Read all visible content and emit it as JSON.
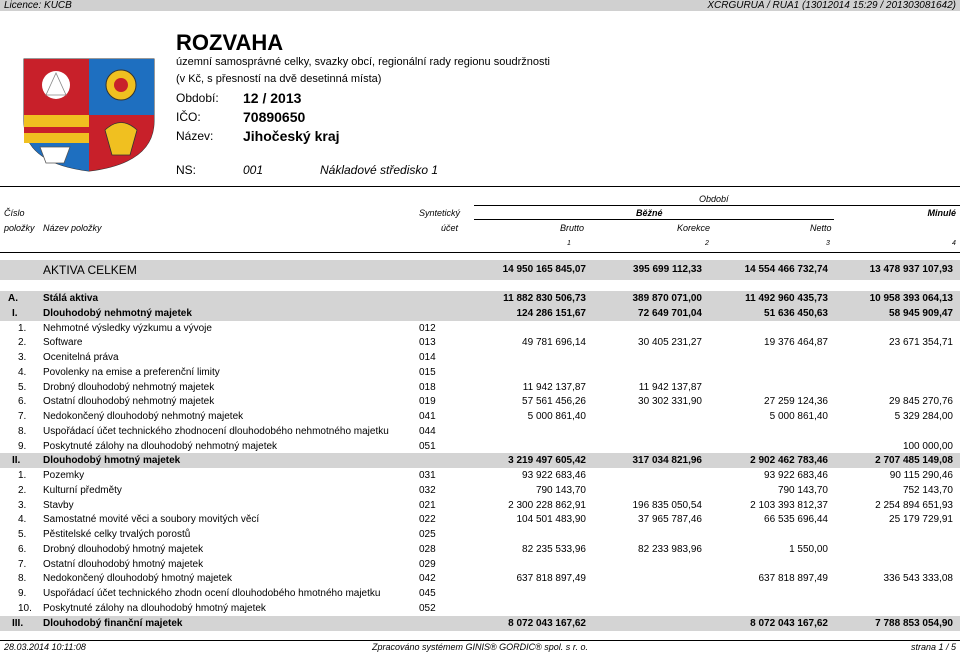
{
  "topbar": {
    "left": "Licence: KUCB",
    "right": "XCRGURUA / RUA1  (13012014 15:29 / 201303081642)"
  },
  "header": {
    "title": "ROZVAHA",
    "subtitle1": "územní samosprávné celky, svazky obcí, regionální rady regionu soudržnosti",
    "subtitle2": "(v Kč, s přesností na dvě desetinná místa)",
    "obdobi_label": "Období:",
    "obdobi_value": "12 / 2013",
    "ico_label": "IČO:",
    "ico_value": "70890650",
    "nazev_label": "Název:",
    "nazev_value": "Jihočeský kraj",
    "ns_label": "NS:",
    "ns_value": "001",
    "ns_name": "Nákladové středisko 1"
  },
  "table_header": {
    "obdobi": "Období",
    "cislo": "Číslo",
    "polozky": "položky",
    "nazev": "Název položky",
    "synteticky": "Syntetický",
    "ucet": "účet",
    "bezne": "Běžné",
    "minule": "Minulé",
    "brutto": "Brutto",
    "korekce": "Korekce",
    "netto": "Netto",
    "n1": "1",
    "n2": "2",
    "n3": "3",
    "n4": "4"
  },
  "aktiva": {
    "label": "AKTIVA CELKEM",
    "brutto": "14 950 165 845,07",
    "korekce": "395 699 112,33",
    "netto": "14 554 466 732,74",
    "minule": "13 478 937 107,93"
  },
  "rows": [
    {
      "num": "A.",
      "name": "Stálá aktiva",
      "acct": "",
      "brutto": "11 882 830 506,73",
      "korekce": "389 870 071,00",
      "netto": "11 492 960 435,73",
      "minule": "10 958 393 064,13",
      "level": "A",
      "bold": true
    },
    {
      "num": "I.",
      "name": "Dlouhodobý nehmotný majetek",
      "acct": "",
      "brutto": "124 286 151,67",
      "korekce": "72 649 701,04",
      "netto": "51 636 450,63",
      "minule": "58 945 909,47",
      "level": "I",
      "bold": true
    },
    {
      "num": "1.",
      "name": "Nehmotné výsledky výzkumu a vývoje",
      "acct": "012",
      "brutto": "",
      "korekce": "",
      "netto": "",
      "minule": "",
      "level": "n"
    },
    {
      "num": "2.",
      "name": "Software",
      "acct": "013",
      "brutto": "49 781 696,14",
      "korekce": "30 405 231,27",
      "netto": "19 376 464,87",
      "minule": "23 671 354,71",
      "level": "n"
    },
    {
      "num": "3.",
      "name": "Ocenitelná práva",
      "acct": "014",
      "brutto": "",
      "korekce": "",
      "netto": "",
      "minule": "",
      "level": "n"
    },
    {
      "num": "4.",
      "name": "Povolenky na emise a preferenční limity",
      "acct": "015",
      "brutto": "",
      "korekce": "",
      "netto": "",
      "minule": "",
      "level": "n"
    },
    {
      "num": "5.",
      "name": "Drobný dlouhodobý nehmotný majetek",
      "acct": "018",
      "brutto": "11 942 137,87",
      "korekce": "11 942 137,87",
      "netto": "",
      "minule": "",
      "level": "n"
    },
    {
      "num": "6.",
      "name": "Ostatní dlouhodobý nehmotný majetek",
      "acct": "019",
      "brutto": "57 561 456,26",
      "korekce": "30 302 331,90",
      "netto": "27 259 124,36",
      "minule": "29 845 270,76",
      "level": "n"
    },
    {
      "num": "7.",
      "name": "Nedokončený dlouhodobý nehmotný majetek",
      "acct": "041",
      "brutto": "5 000 861,40",
      "korekce": "",
      "netto": "5 000 861,40",
      "minule": "5 329 284,00",
      "level": "n"
    },
    {
      "num": "8.",
      "name": "Uspořádací účet technického zhodnocení dlouhodobého nehmotného majetku",
      "acct": "044",
      "brutto": "",
      "korekce": "",
      "netto": "",
      "minule": "",
      "level": "n"
    },
    {
      "num": "9.",
      "name": "Poskytnuté zálohy na dlouhodobý nehmotný majetek",
      "acct": "051",
      "brutto": "",
      "korekce": "",
      "netto": "",
      "minule": "100 000,00",
      "level": "n"
    },
    {
      "num": "II.",
      "name": "Dlouhodobý hmotný majetek",
      "acct": "",
      "brutto": "3 219 497 605,42",
      "korekce": "317 034 821,96",
      "netto": "2 902 462 783,46",
      "minule": "2 707 485 149,08",
      "level": "I",
      "bold": true
    },
    {
      "num": "1.",
      "name": "Pozemky",
      "acct": "031",
      "brutto": "93 922 683,46",
      "korekce": "",
      "netto": "93 922 683,46",
      "minule": "90 115 290,46",
      "level": "n"
    },
    {
      "num": "2.",
      "name": "Kulturní předměty",
      "acct": "032",
      "brutto": "790 143,70",
      "korekce": "",
      "netto": "790 143,70",
      "minule": "752 143,70",
      "level": "n"
    },
    {
      "num": "3.",
      "name": "Stavby",
      "acct": "021",
      "brutto": "2 300 228 862,91",
      "korekce": "196 835 050,54",
      "netto": "2 103 393 812,37",
      "minule": "2 254 894 651,93",
      "level": "n"
    },
    {
      "num": "4.",
      "name": "Samostatné movité věci a soubory movitých věcí",
      "acct": "022",
      "brutto": "104 501 483,90",
      "korekce": "37 965 787,46",
      "netto": "66 535 696,44",
      "minule": "25 179 729,91",
      "level": "n"
    },
    {
      "num": "5.",
      "name": "Pěstitelské celky trvalých porostů",
      "acct": "025",
      "brutto": "",
      "korekce": "",
      "netto": "",
      "minule": "",
      "level": "n"
    },
    {
      "num": "6.",
      "name": "Drobný dlouhodobý hmotný majetek",
      "acct": "028",
      "brutto": "82 235 533,96",
      "korekce": "82 233 983,96",
      "netto": "1 550,00",
      "minule": "",
      "level": "n"
    },
    {
      "num": "7.",
      "name": "Ostatní dlouhodobý hmotný majetek",
      "acct": "029",
      "brutto": "",
      "korekce": "",
      "netto": "",
      "minule": "",
      "level": "n"
    },
    {
      "num": "8.",
      "name": "Nedokončený dlouhodobý hmotný majetek",
      "acct": "042",
      "brutto": "637 818 897,49",
      "korekce": "",
      "netto": "637 818 897,49",
      "minule": "336 543 333,08",
      "level": "n"
    },
    {
      "num": "9.",
      "name": "Uspořádací účet technického zhodn ocení dlouhodobého hmotného majetku",
      "acct": "045",
      "brutto": "",
      "korekce": "",
      "netto": "",
      "minule": "",
      "level": "n"
    },
    {
      "num": "10.",
      "name": "Poskytnuté zálohy na dlouhodobý hmotný majetek",
      "acct": "052",
      "brutto": "",
      "korekce": "",
      "netto": "",
      "minule": "",
      "level": "n"
    },
    {
      "num": "III.",
      "name": "Dlouhodobý finanční majetek",
      "acct": "",
      "brutto": "8 072 043 167,62",
      "korekce": "",
      "netto": "8 072 043 167,62",
      "minule": "7 788 853 054,90",
      "level": "I",
      "bold": true
    }
  ],
  "footer": {
    "left": "28.03.2014 10:11:08",
    "center": "Zpracováno systémem  GINIS® GORDIC® spol. s  r. o.",
    "right": "strana 1 / 5"
  }
}
